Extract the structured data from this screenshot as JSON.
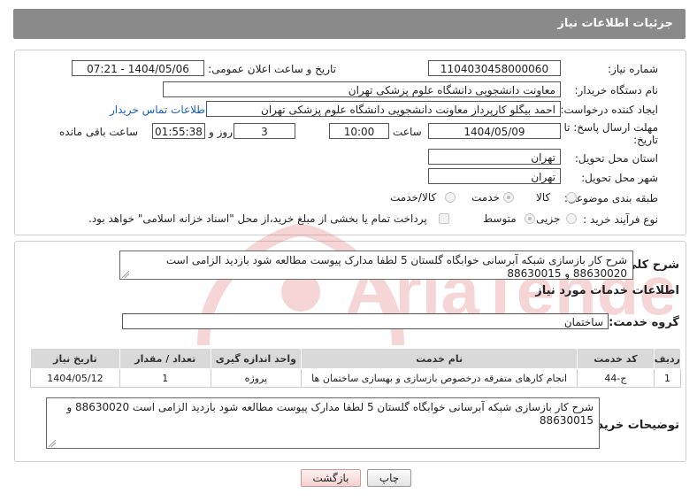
{
  "header": {
    "title": "جزئیات اطلاعات نیاز"
  },
  "info": {
    "need_number_label": "شماره نیاز:",
    "need_number": "1104030458000060",
    "announce_label": "تاریخ و ساعت اعلان عمومی:",
    "announce_value": "1404/05/06 - 07:21",
    "buyer_label": "نام دستگاه خریدار:",
    "buyer_value": "معاونت دانشجویی دانشگاه علوم پزشکی تهران",
    "creator_label": "ایجاد کننده درخواست:",
    "creator_value": "احمد بیگلو کارپرداز معاونت دانشجویی دانشگاه علوم پزشکی تهران",
    "contact_link": "اطلاعات تماس خریدار",
    "deadline_label_1": "مهلت ارسال پاسخ: تا",
    "deadline_label_2": "تاریخ:",
    "deadline_date": "1404/05/09",
    "time_label": "ساعت",
    "deadline_time": "10:00",
    "days_value": "3",
    "days_label": "روز و",
    "remaining_time": "01:55:38",
    "remaining_label": "ساعت باقی مانده",
    "province_label": "استان محل تحویل:",
    "province_value": "تهران",
    "city_label": "شهر محل تحویل:",
    "city_value": "تهران",
    "category_label": "طبقه بندی موضوعی:",
    "category_options": [
      "کالا",
      "خدمت",
      "کالا/خدمت"
    ],
    "process_label": "نوع فرآیند خرید :",
    "process_options": [
      "جزیی",
      "متوسط"
    ],
    "payment_note": "پرداخت تمام یا بخشی از مبلغ خرید،از محل \"اسناد خزانه اسلامی\" خواهد بود."
  },
  "description": {
    "label": "شرح کلی نیاز:",
    "text": "شرح کار بازسازی شبکه آبرسانی خوابگاه گلستان 5 لطفا مدارک پیوست مطالعه شود بازدید الزامی است 88630020 و 88630015"
  },
  "services": {
    "section_title": "اطلاعات خدمات مورد نیاز",
    "group_label": "گروه خدمت:",
    "group_value": "ساختمان",
    "columns": [
      "ردیف",
      "کد خدمت",
      "نام خدمت",
      "واحد اندازه گیری",
      "تعداد / مقدار",
      "تاریخ نیاز"
    ],
    "rows": [
      [
        "1",
        "ج-44",
        "انجام کارهای متفرقه درخصوص بازسازی و بهسازی ساختمان ها",
        "پروژه",
        "1",
        "1404/05/12"
      ]
    ]
  },
  "buyer_notes": {
    "label": "توضیحات خریدار:",
    "text": "شرح کار بازسازی شبکه آبرسانی خوابگاه گلستان 5 لطفا مدارک پیوست مطالعه شود بازدید الزامی است 88630020 و 88630015"
  },
  "buttons": {
    "print": "چاپ",
    "back": "بازگشت"
  },
  "watermark": {
    "text": "AriaTender.neT"
  },
  "colors": {
    "header_bg": "#8a8a8a",
    "table_header_bg": "#d9d9d9",
    "link": "#1a5fb4",
    "watermark": "#d64545"
  }
}
